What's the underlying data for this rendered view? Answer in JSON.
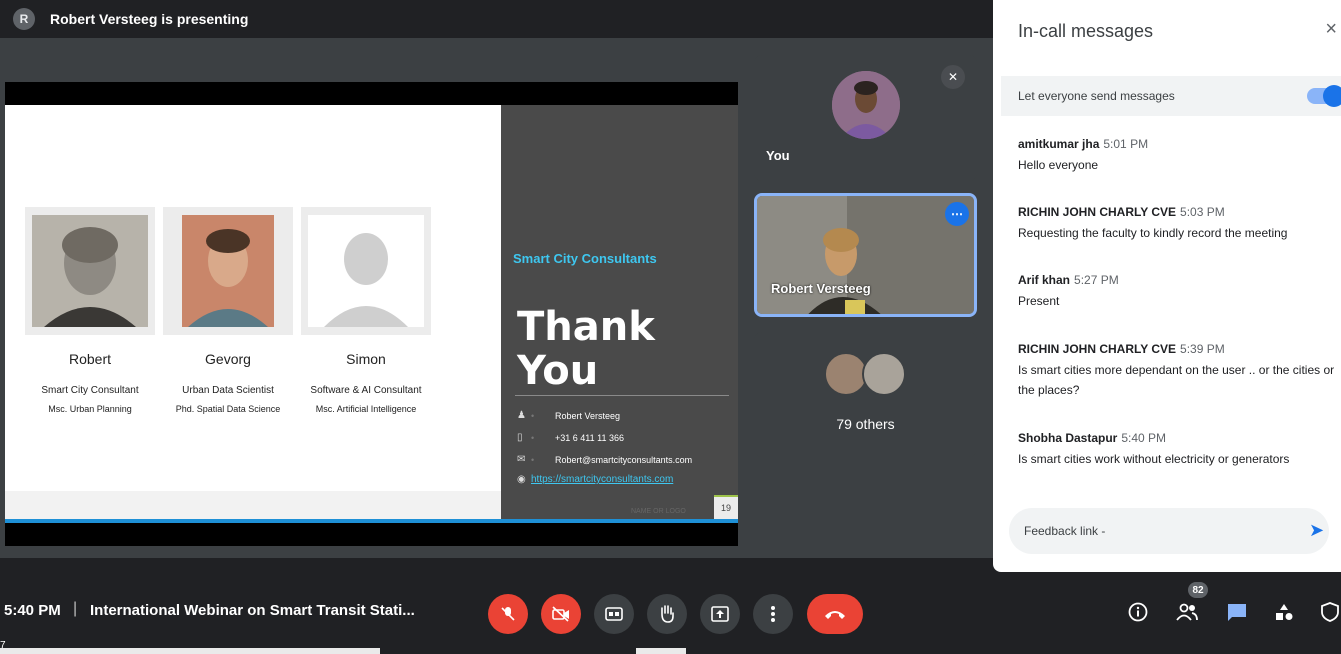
{
  "presenter": {
    "initial": "R",
    "text": "Robert Versteeg is presenting"
  },
  "slide": {
    "people": [
      {
        "name": "Robert",
        "role": "Smart City Consultant",
        "degree": "Msc. Urban Planning"
      },
      {
        "name": "Gevorg",
        "role": "Urban Data Scientist",
        "degree": "Phd. Spatial Data Science"
      },
      {
        "name": "Simon",
        "role": "Software & AI Consultant",
        "degree": "Msc. Artificial Intelligence"
      }
    ],
    "company": "Smart City Consultants",
    "thank_line1": "Thank",
    "thank_line2": "You",
    "contact": {
      "name": "Robert Versteeg",
      "phone": "+31 6 411 11 366",
      "email": "Robert@smartcityconsultants.com",
      "url": "https://smartcityconsultants.com"
    },
    "footer_logo": "NAME OR LOGO",
    "page_number": "19"
  },
  "tiles": {
    "you_label": "You",
    "robert_label": "Robert Versteeg",
    "others_label": "79 others"
  },
  "panel": {
    "title": "In-call messages",
    "close": "×",
    "toggle_label": "Let everyone send messages",
    "messages": [
      {
        "sender": "amitkumar jha",
        "time": "5:01 PM",
        "text": "Hello everyone"
      },
      {
        "sender": "RICHIN JOHN CHARLY CVE",
        "time": "5:03 PM",
        "text": "Requesting the faculty to kindly record the meeting"
      },
      {
        "sender": "Arif khan",
        "time": "5:27 PM",
        "text": "Present"
      },
      {
        "sender": "RICHIN JOHN CHARLY CVE",
        "time": "5:39 PM",
        "text": "Is smart cities more dependant on the user .. or the cities or the places?"
      },
      {
        "sender": "Shobha Dastapur",
        "time": "5:40 PM",
        "text": "Is smart cities work without electricity or generators"
      }
    ],
    "input_value": "Feedback link -"
  },
  "bottom": {
    "time": "5:40 PM",
    "separator": "|",
    "meeting_title": "International Webinar on Smart Transit Stati...",
    "people_count": "82"
  },
  "corner_digit": "7",
  "colors": {
    "accent": "#1a73e8",
    "danger": "#ea4335",
    "bg": "#202124",
    "slide_title": "#3ec7f0"
  }
}
